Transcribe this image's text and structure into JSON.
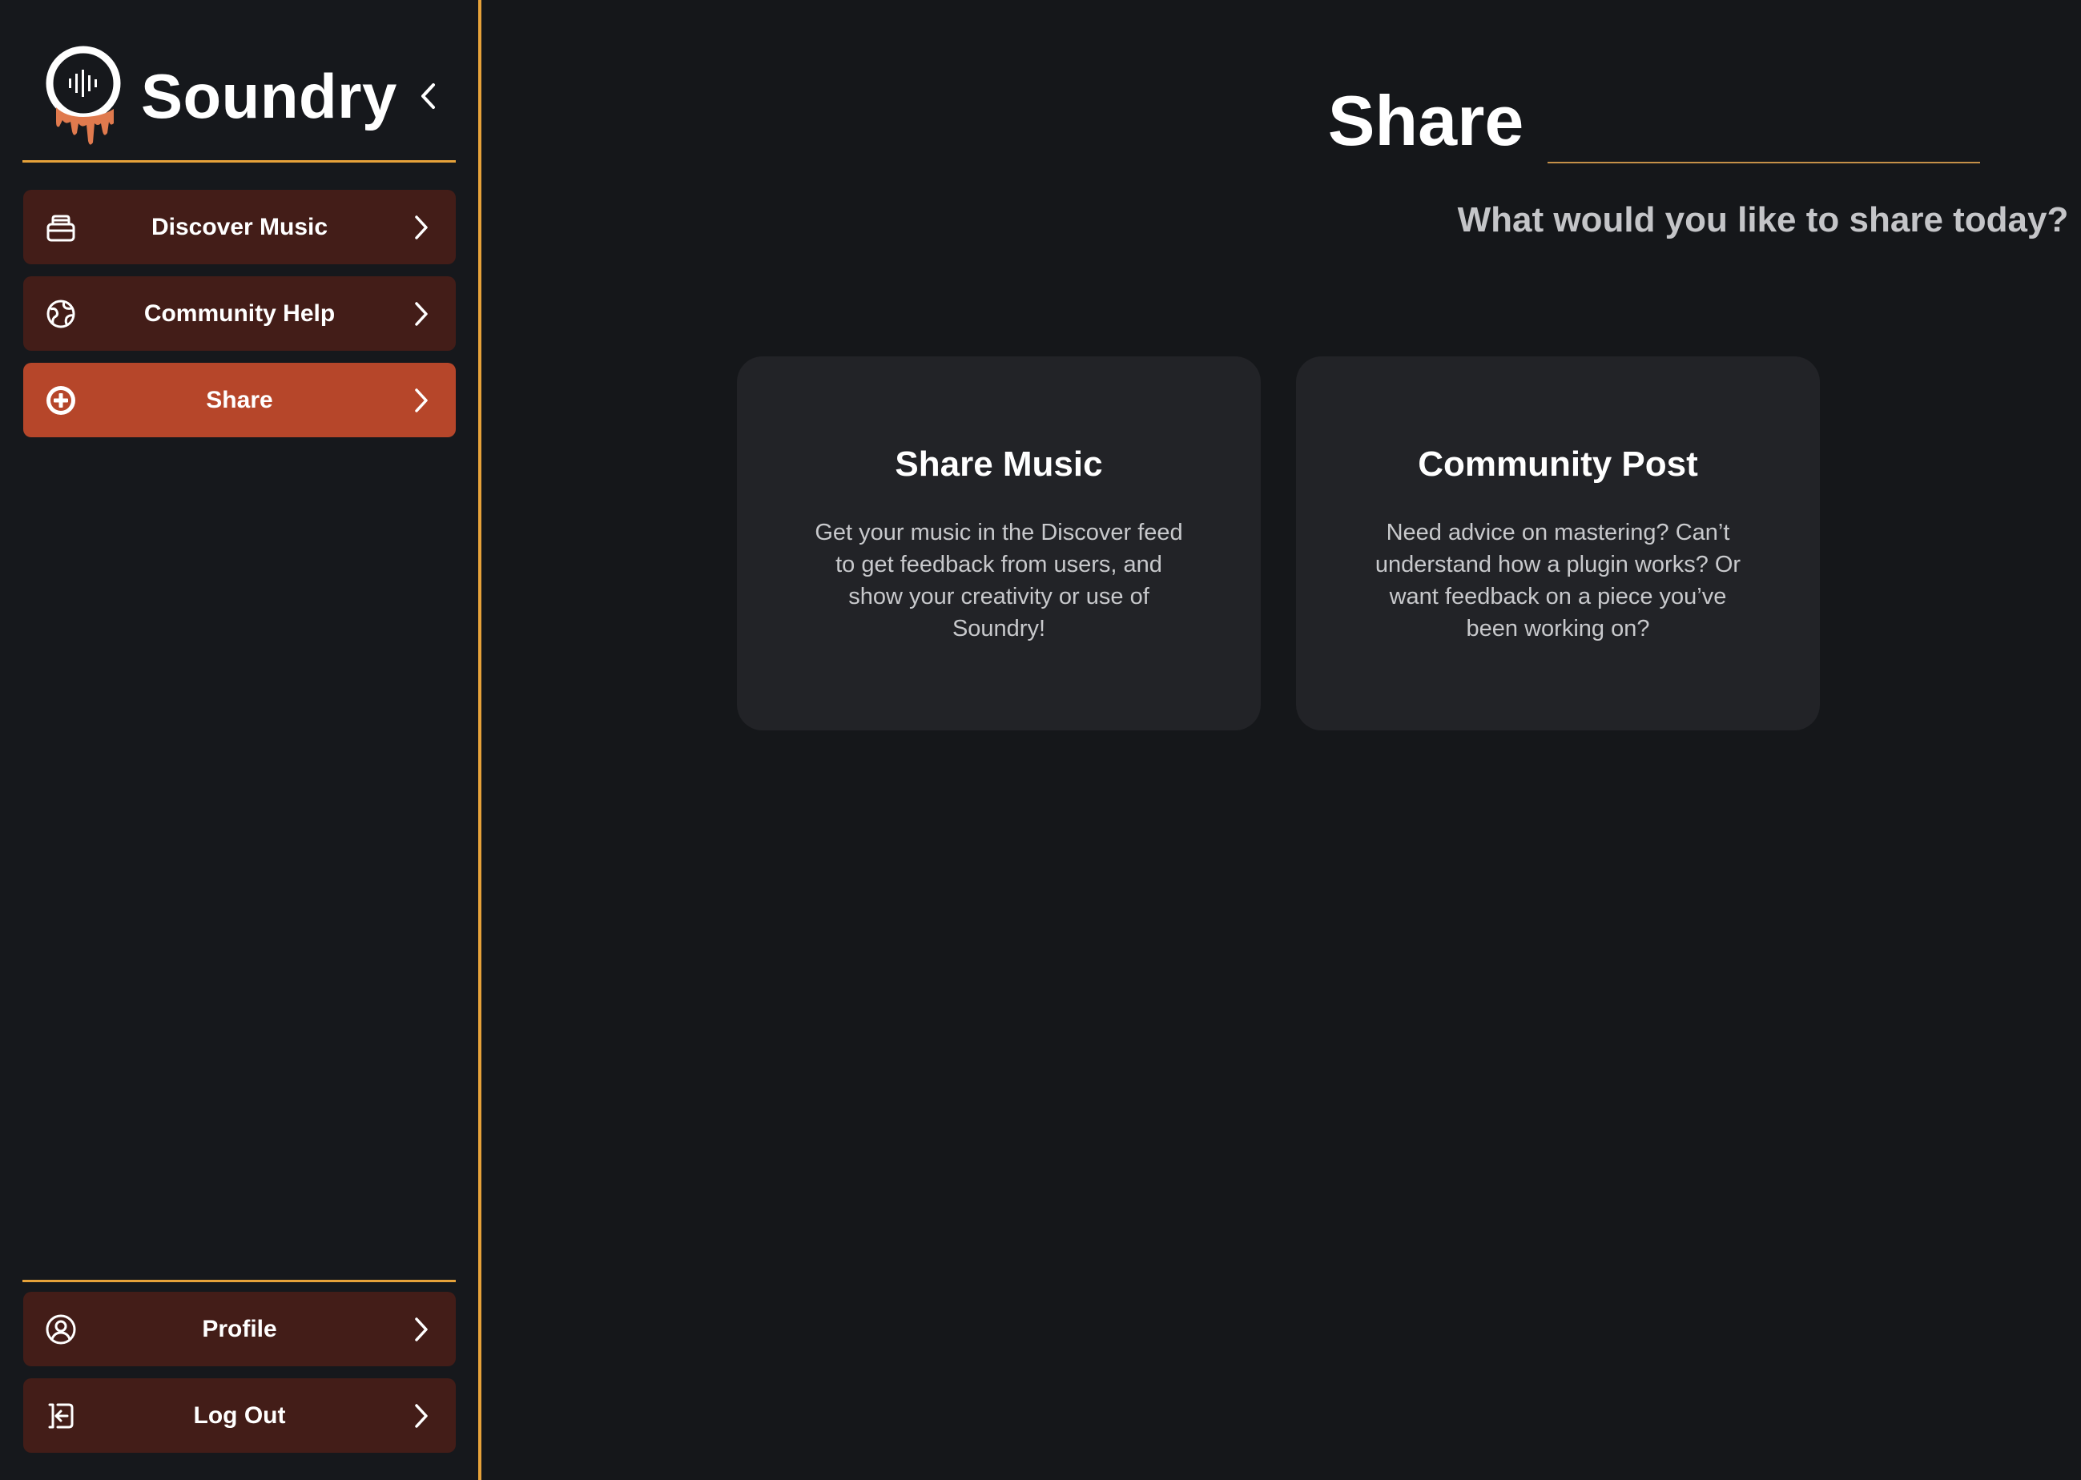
{
  "brand": {
    "name": "Soundry",
    "accent_color": "#e6a23a",
    "logo_drip_color": "#e07a4e",
    "collapse_icon": "chevron-left-icon"
  },
  "sidebar": {
    "items": [
      {
        "label": "Discover Music",
        "icon": "archive-box-icon",
        "active": false
      },
      {
        "label": "Community Help",
        "icon": "globe-icon",
        "active": false
      },
      {
        "label": "Share",
        "icon": "plus-circle-icon",
        "active": true
      }
    ],
    "footer_items": [
      {
        "label": "Profile",
        "icon": "user-circle-icon"
      },
      {
        "label": "Log Out",
        "icon": "logout-icon"
      }
    ],
    "item_bg": "#431d18",
    "active_bg": "#b6462a"
  },
  "main": {
    "title": "Share",
    "subtitle": "What would you like to share today?",
    "cards": [
      {
        "title": "Share Music",
        "description": "Get your music in the Discover feed to get feedback from users, and show your creativity or use of Soundry!"
      },
      {
        "title": "Community Post",
        "description": "Need advice on mastering? Can’t understand how a plugin works? Or want feedback on a piece you’ve been working on?"
      }
    ]
  }
}
